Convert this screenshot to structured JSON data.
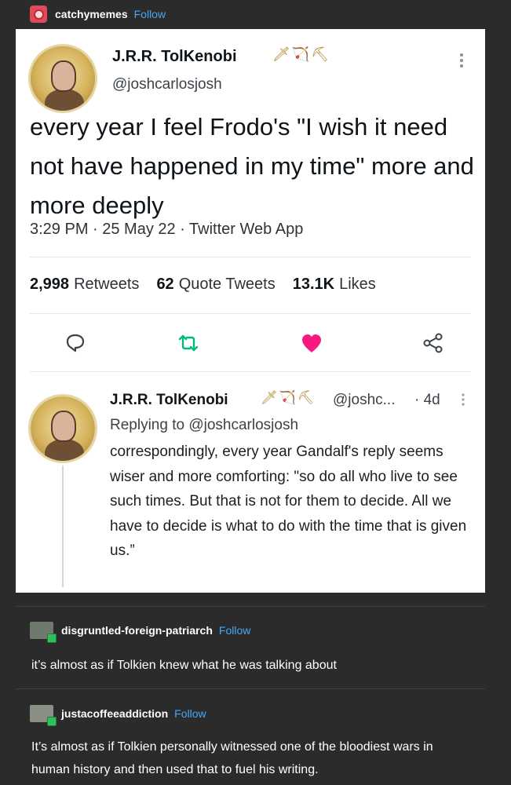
{
  "op": {
    "blog_name": "catchymemes",
    "follow_label": "Follow"
  },
  "tweet": {
    "display_name": "J.R.R. TolKenobi",
    "name_emojis": "🗡🏹⛏",
    "handle": "@joshcarlosjosh",
    "text": "every year I feel Frodo's \"I wish it need not have happened in my time\" more and more deeply",
    "meta": "3:29 PM · 25 May 22 · Twitter Web App",
    "stats": {
      "retweets_count": "2,998",
      "retweets_label": "Retweets",
      "quotes_count": "62",
      "quotes_label": "Quote Tweets",
      "likes_count": "13.1K",
      "likes_label": "Likes"
    },
    "actions": {
      "reply_icon": "reply-icon",
      "retweet_icon": "retweet-icon",
      "like_icon": "heart-icon",
      "share_icon": "share-icon"
    },
    "colors": {
      "heart": "#f91880",
      "retweet": "#00ba7c",
      "text": "#0f1419"
    }
  },
  "reply": {
    "display_name": "J.R.R. TolKenobi",
    "name_emojis": "🗡🏹⛏",
    "handle": "@joshc...",
    "time": "· 4d",
    "replying_to": "Replying to @joshcarlosjosh",
    "text": "correspondingly, every year Gandalf's reply seems wiser and more comforting: \"so do all who live to see such times. But that is not for them to decide. All we have to decide is what to do with the time that is given us.”"
  },
  "reblogs": [
    {
      "blog_name": "disgruntled-foreign-patriarch",
      "follow_label": "Follow",
      "text": "it’s almost as if Tolkien knew what he was talking about"
    },
    {
      "blog_name": "justacoffeeaddiction",
      "follow_label": "Follow",
      "text": "It’s almost as if Tolkien personally witnessed one of the bloodiest wars in human history and then used that to fuel his writing."
    }
  ]
}
